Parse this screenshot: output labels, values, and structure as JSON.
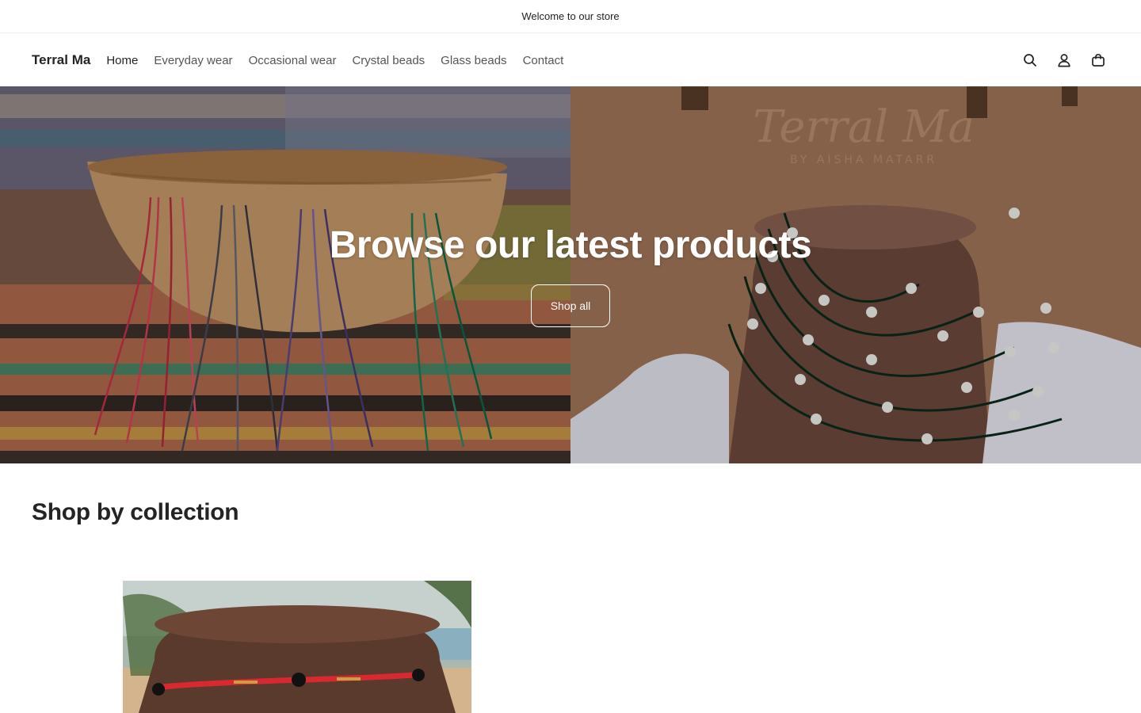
{
  "announcement": {
    "text": "Welcome to our store"
  },
  "header": {
    "logo": "Terral Ma",
    "nav": [
      {
        "label": "Home",
        "active": true
      },
      {
        "label": "Everyday wear",
        "active": false
      },
      {
        "label": "Occasional wear",
        "active": false
      },
      {
        "label": "Crystal beads",
        "active": false
      },
      {
        "label": "Glass beads",
        "active": false
      },
      {
        "label": "Contact",
        "active": false
      }
    ],
    "icons": [
      "search-icon",
      "account-icon",
      "cart-icon"
    ]
  },
  "hero": {
    "title": "Browse our latest products",
    "button_label": "Shop all",
    "images": [
      "beaded-strands-in-wooden-bowl",
      "beaded-necklaces-on-bust"
    ]
  },
  "collections": {
    "heading": "Shop by collection",
    "cards": [
      {
        "image": "red-waist-beads-on-bust"
      }
    ]
  },
  "colors": {
    "text": "#242424",
    "nav_text": "#555555",
    "border": "#ececec",
    "background": "#ffffff"
  }
}
